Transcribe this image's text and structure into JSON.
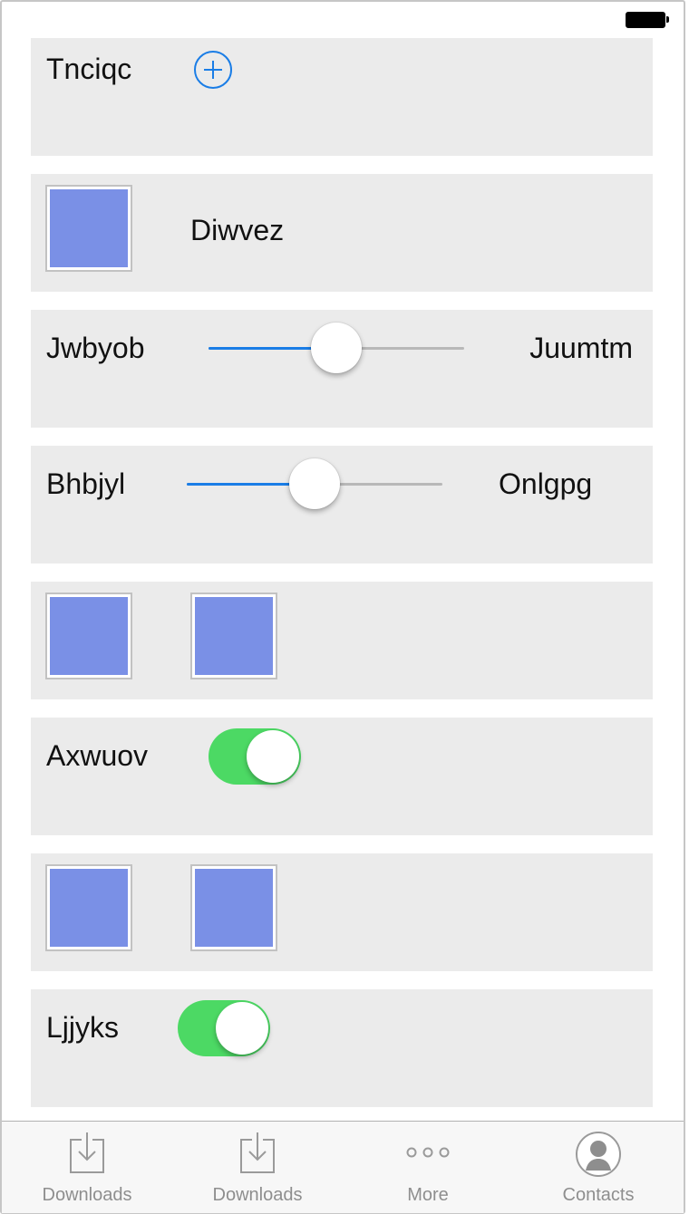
{
  "rows": {
    "row1": {
      "label": "Tnciqc"
    },
    "row2": {
      "label": "Diwvez"
    },
    "row3": {
      "left_label": "Jwbyob",
      "right_label": "Juumtm",
      "value_percent": 50
    },
    "row4": {
      "left_label": "Bhbjyl",
      "right_label": "Onlgpg",
      "value_percent": 50
    },
    "row6": {
      "label": "Axwuov",
      "on": true
    },
    "row8": {
      "label": "Ljjyks",
      "on": true
    }
  },
  "tabbar": {
    "tabs": [
      {
        "label": "Downloads",
        "icon": "download-icon"
      },
      {
        "label": "Downloads",
        "icon": "download-icon"
      },
      {
        "label": "More",
        "icon": "more-icon"
      },
      {
        "label": "Contacts",
        "icon": "contacts-icon"
      }
    ]
  },
  "colors": {
    "accent": "#1a7de6",
    "toggle_on": "#4cd964",
    "swatch": "#7a90e6",
    "row_bg": "#ebebeb"
  }
}
